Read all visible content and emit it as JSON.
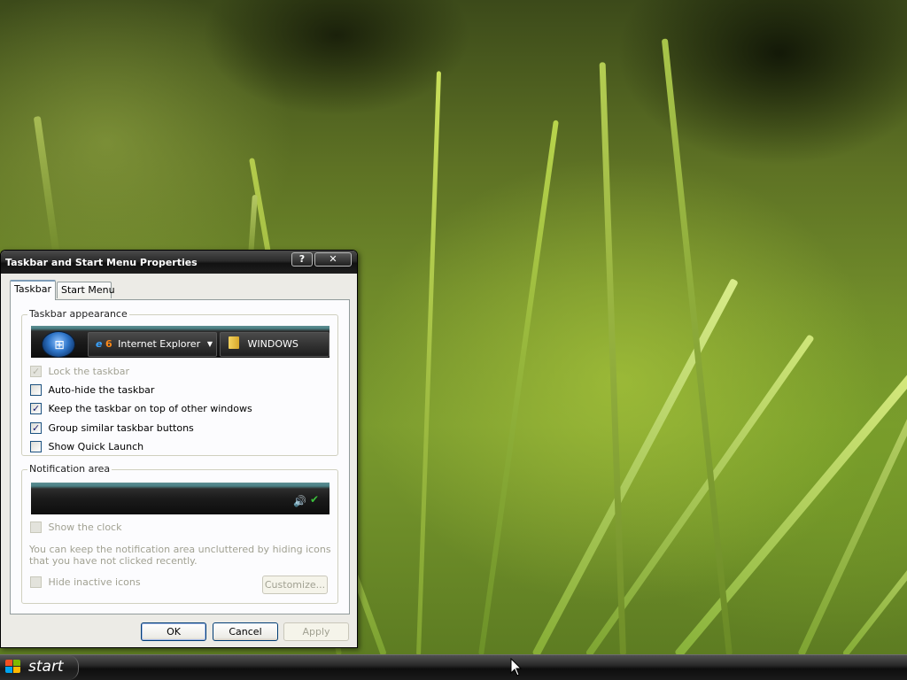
{
  "dialog": {
    "title": "Taskbar and Start Menu Properties",
    "help_btn": "?",
    "close_btn": "✕",
    "tabs": [
      {
        "label": "Taskbar",
        "active": true
      },
      {
        "label": "Start Menu",
        "active": false
      }
    ],
    "appearance": {
      "group_label": "Taskbar appearance",
      "preview": {
        "ie_number": "6",
        "ie_label": "Internet Explorer",
        "folder_label": "WINDOWS"
      },
      "options": [
        {
          "label": "Lock the taskbar",
          "checked": true,
          "disabled": true
        },
        {
          "label": "Auto-hide the taskbar",
          "checked": false,
          "disabled": false
        },
        {
          "label": "Keep the taskbar on top of other windows",
          "checked": true,
          "disabled": false
        },
        {
          "label": "Group similar taskbar buttons",
          "checked": true,
          "disabled": false
        },
        {
          "label": "Show Quick Launch",
          "checked": false,
          "disabled": false
        }
      ]
    },
    "notification": {
      "group_label": "Notification area",
      "show_clock": {
        "label": "Show the clock",
        "checked": false,
        "disabled": true
      },
      "help_text": "You can keep the notification area uncluttered by hiding icons that you have not clicked recently.",
      "hide_inactive": {
        "label": "Hide inactive icons",
        "checked": false,
        "disabled": true
      },
      "customize_label": "Customize..."
    },
    "buttons": {
      "ok": "OK",
      "cancel": "Cancel",
      "apply": "Apply"
    }
  },
  "taskbar": {
    "start_label": "start"
  },
  "colors": {
    "xp_blue_border": "#003c74",
    "disabled_text": "#a1a192",
    "panel_bg": "#fcfcfe",
    "dialog_bg": "#ecebe6"
  }
}
